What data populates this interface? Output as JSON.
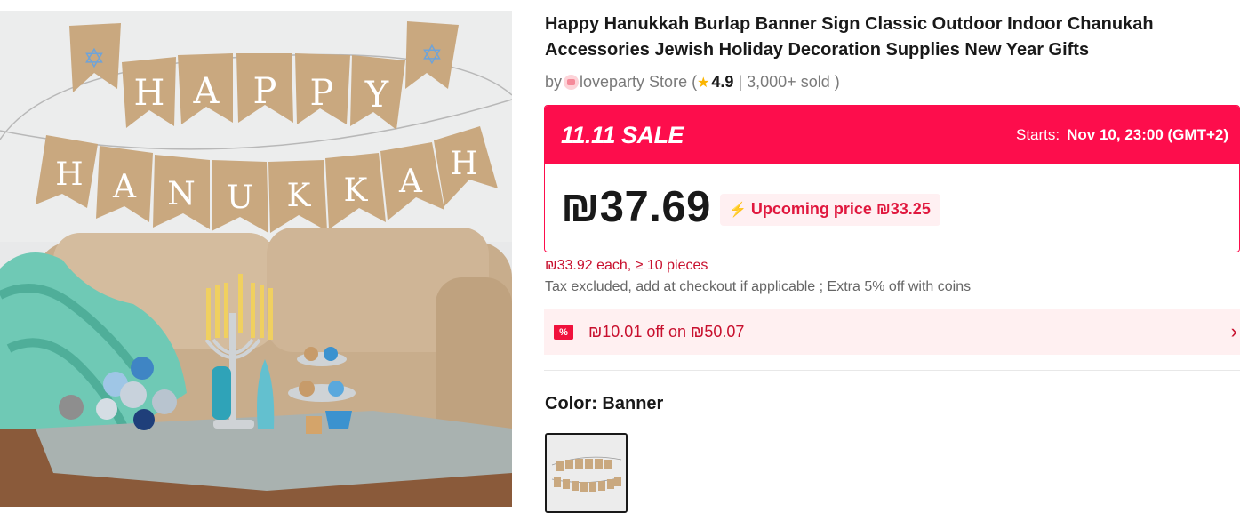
{
  "product": {
    "image_alt": "Happy Hanukkah burlap banner over a sofa with a menorah",
    "banner_word_top": [
      "H",
      "A",
      "P",
      "P",
      "Y"
    ],
    "banner_word_bottom": [
      "H",
      "A",
      "N",
      "U",
      "K",
      "K",
      "A",
      "H"
    ],
    "title": "Happy Hanukkah Burlap Banner Sign Classic Outdoor Indoor Chanukah Accessories Jewish Holiday Decoration Supplies New Year Gifts"
  },
  "store": {
    "by_label": "by",
    "name": "loveparty Store",
    "open_paren": "(",
    "rating": "4.9",
    "separator": "|",
    "sold": "3,000+ sold",
    "close_paren": ")",
    "star_icon": "star-icon"
  },
  "sale": {
    "tag": "11.11 SALE",
    "starts_label": "Starts:",
    "starts_value": "Nov 10, 23:00 (GMT+2)",
    "price": "₪37.69",
    "upcoming_label": "Upcoming price ₪33.25"
  },
  "bulk_price": "₪33.92 each, ≥ 10 pieces",
  "tax_note": "Tax excluded, add at checkout if applicable ; Extra 5% off with coins",
  "coupon": {
    "icon_text": "%",
    "text": "₪10.01 off on ₪50.07",
    "chevron_icon": "chevron-right-icon"
  },
  "color": {
    "label": "Color: Banner",
    "selected_option": "Banner"
  },
  "colors": {
    "sale_red": "#fd0d4c",
    "price_red": "#c8102e",
    "coupon_bg": "#fff0f1"
  }
}
